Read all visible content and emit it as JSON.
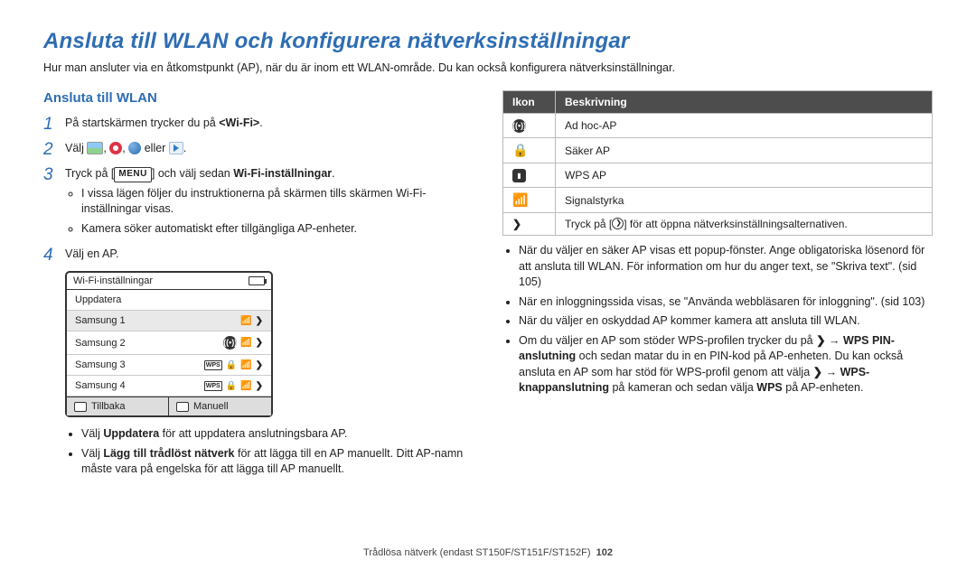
{
  "title": "Ansluta till WLAN och konfigurera nätverksinställningar",
  "intro": "Hur man ansluter via en åtkomstpunkt (AP), när du är inom ett WLAN-område. Du kan också konfigurera nätverksinställningar.",
  "section_title": "Ansluta till WLAN",
  "steps": {
    "s1_pre": "På startskärmen trycker du på ",
    "s1_bold": "<Wi-Fi>",
    "s1_post": ".",
    "s2_pre": "Välj ",
    "s2_mid": ", ",
    "s2_eller": " eller ",
    "s2_post": ".",
    "s3_pre": "Tryck på [",
    "s3_menu": "MENU",
    "s3_mid": "] och välj sedan ",
    "s3_bold": "Wi-Fi-inställningar",
    "s3_post": ".",
    "s3_b1": "I vissa lägen följer du instruktionerna på skärmen tills skärmen Wi-Fi-inställningar visas.",
    "s3_b2": "Kamera söker automatiskt efter tillgängliga AP-enheter.",
    "s4": "Välj en AP."
  },
  "device": {
    "title": "Wi-Fi-inställningar",
    "rows": [
      "Uppdatera",
      "Samsung 1",
      "Samsung 2",
      "Samsung 3",
      "Samsung 4"
    ],
    "back": "Tillbaka",
    "manual": "Manuell"
  },
  "under_device": {
    "b1_pre": "Välj ",
    "b1_b": "Uppdatera",
    "b1_post": " för att uppdatera anslutningsbara AP.",
    "b2_pre": "Välj ",
    "b2_b": "Lägg till trådlöst nätverk",
    "b2_post": " för att lägga till en AP manuellt. Ditt AP-namn måste vara på engelska för att lägga till AP manuellt."
  },
  "table": {
    "h1": "Ikon",
    "h2": "Beskrivning",
    "r1": "Ad hoc-AP",
    "r2": "Säker AP",
    "r3": "WPS AP",
    "r4": "Signalstyrka",
    "r5_pre": "Tryck på [",
    "r5_post": "] för att öppna nätverksinställningsalternativen."
  },
  "right": {
    "b1": "När du väljer en säker AP visas ett popup-fönster. Ange obligatoriska lösenord för att ansluta till WLAN. För information om hur du anger text, se \"Skriva text\". (sid 105)",
    "b2": "När en inloggningssida visas, se \"Använda webbläsaren för inloggning\". (sid 103)",
    "b3": "När du väljer en oskyddad AP kommer kamera att ansluta till WLAN.",
    "b4_pre": "Om du väljer en AP som stöder WPS-profilen trycker du på ",
    "b4_arrow": " → ",
    "b4_b1": "WPS PIN-anslutning",
    "b4_mid": " och sedan matar du in en PIN-kod på AP-enheten. Du kan också ansluta en AP som har stöd för WPS-profil genom att välja ",
    "b4_b2": "WPS-knappanslutning",
    "b4_mid2": " på kameran och sedan välja ",
    "b4_b3": "WPS",
    "b4_post": " på AP-enheten."
  },
  "footer_text": "Trådlösa nätverk (endast ST150F/ST151F/ST152F)",
  "page_num": "102"
}
